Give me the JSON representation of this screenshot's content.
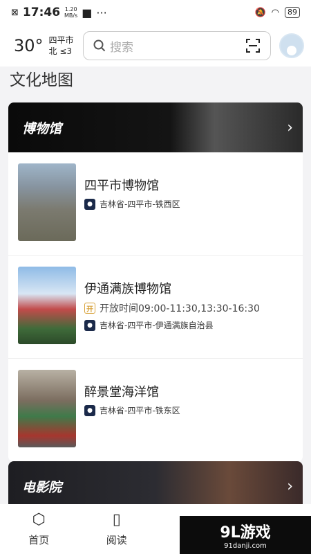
{
  "status": {
    "time": "17:46",
    "speed_value": "1.20",
    "speed_unit": "MB/s",
    "more": "···",
    "battery": "89"
  },
  "header": {
    "temperature": "30°",
    "city": "四平市",
    "wind": "北 ≤3",
    "search_placeholder": "搜索"
  },
  "page": {
    "title": "文化地图"
  },
  "museum_section": {
    "title": "博物馆",
    "items": [
      {
        "name": "四平市博物馆",
        "address": "吉林省-四平市-铁西区"
      },
      {
        "name": "伊通满族博物馆",
        "open_label": "开",
        "hours": "开放时间09:00-11:30,13:30-16:30",
        "address": "吉林省-四平市-伊通满族自治县"
      },
      {
        "name": "醉景堂海洋馆",
        "address": "吉林省-四平市-铁东区"
      }
    ]
  },
  "cinema_section": {
    "title": "电影院"
  },
  "tabbar": {
    "home": "首页",
    "read": "阅读"
  },
  "watermark": {
    "logo": "9L游戏",
    "url": "91danji.com"
  },
  "icons": {
    "search": "search-icon",
    "scan": "scan-icon",
    "chevron": "chevron-right-icon",
    "pin": "location-pin-icon"
  }
}
